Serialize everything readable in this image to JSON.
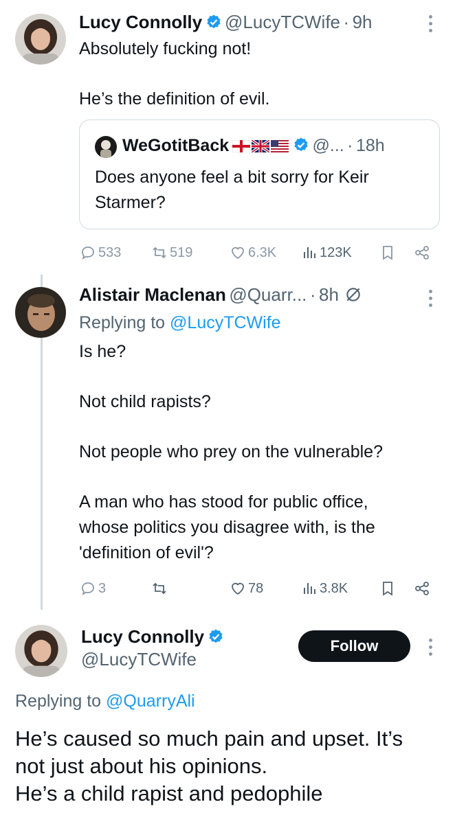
{
  "tweet1": {
    "name": "Lucy Connolly",
    "handle": "@LucyTCWife",
    "dot": "·",
    "time": "9h",
    "line1": "Absolutely fucking not!",
    "line2": "He’s the definition of evil.",
    "quote": {
      "name": "WeGotitBack",
      "handle": "@...",
      "dot": "·",
      "time": "18h",
      "line1": "Does anyone feel a bit sorry for Keir",
      "line2": "Starmer?"
    },
    "stats": {
      "replies": "533",
      "retweets": "519",
      "likes": "6.3K",
      "views": "123K"
    }
  },
  "tweet2": {
    "name": "Alistair Maclenan",
    "handle": "@Quarr...",
    "dot": "·",
    "time": "8h",
    "replying_prefix": "Replying to",
    "replying_handle": "@LucyTCWife",
    "line1": "Is he?",
    "line2": "Not child rapists?",
    "line3": "Not people who prey on the vulnerable?",
    "line4": "A man who has stood for public office,",
    "line5": "whose politics you disagree with, is the",
    "line6": "'definition of evil'?",
    "stats": {
      "replies": "3",
      "likes": "78",
      "views": "3.8K"
    }
  },
  "tweet3": {
    "name": "Lucy Connolly",
    "handle": "@LucyTCWife",
    "follow_label": "Follow",
    "replying_prefix": "Replying to",
    "replying_handle": "@QuarryAli",
    "line1": "He’s caused so much pain and upset. It’s",
    "line2": "not just about his opinions.",
    "line3": "He’s a child rapist and pedophile"
  },
  "colors": {
    "accent": "#1d9bf0",
    "text": "#0f1419",
    "muted": "#536471",
    "border": "#cfd9de"
  }
}
